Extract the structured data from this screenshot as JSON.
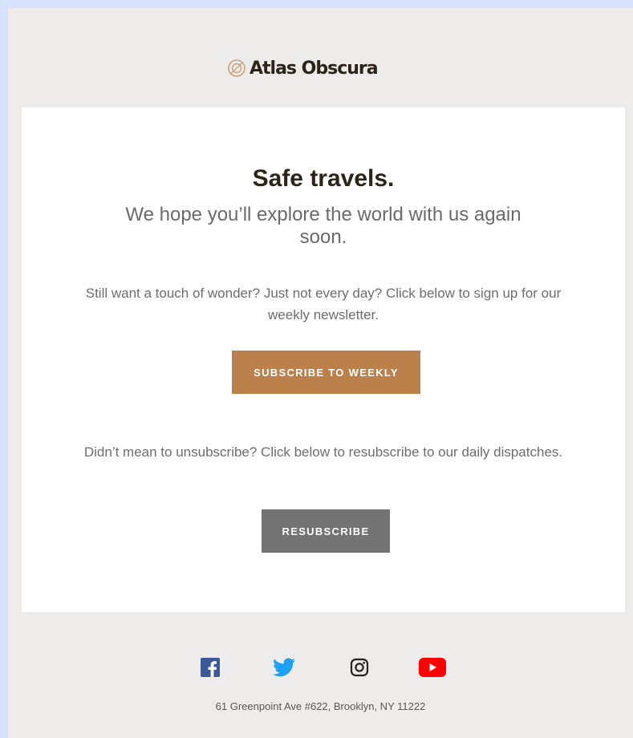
{
  "brand": {
    "name": "Atlas Obscura",
    "logo_icon": "atlas-obscura-logo-icon",
    "logo_color": "#c9a37a",
    "text_color": "#2c2418"
  },
  "card": {
    "title": "Safe travels.",
    "subtitle": "We hope you’ll explore the world with us again soon.",
    "paragraph_1": "Still want a touch of wonder? Just not every day? Click below to sign up for our weekly newsletter.",
    "weekly_button": "SUBSCRIBE TO WEEKLY",
    "paragraph_2": "Didn’t mean to unsubscribe? Click below to resubscribe to our daily dispatches.",
    "resubscribe_button": "RESUBSCRIBE"
  },
  "colors": {
    "page_background": "#d6e2fb",
    "frame_background": "#edecea",
    "weekly_button": "#bc804a",
    "resubscribe_button": "#737373"
  },
  "social": [
    {
      "name": "facebook-icon",
      "color": "#3b5998"
    },
    {
      "name": "twitter-icon",
      "color": "#1da1f2"
    },
    {
      "name": "instagram-icon",
      "color": "#222222"
    },
    {
      "name": "youtube-icon",
      "color": "#ff0000"
    }
  ],
  "footer": {
    "address": "61 Greenpoint Ave #622, Brooklyn, NY 11222"
  }
}
